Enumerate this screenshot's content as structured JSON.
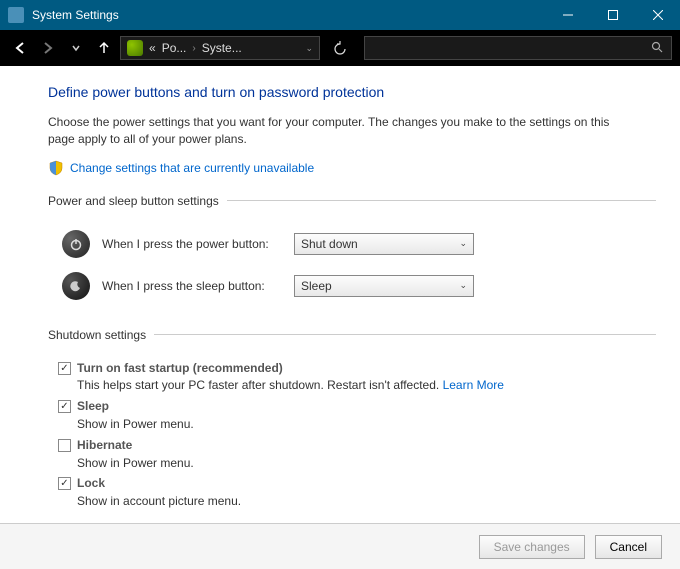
{
  "window": {
    "title": "System Settings"
  },
  "breadcrumb": {
    "segment1": "Po...",
    "segment2": "Syste..."
  },
  "page": {
    "heading": "Define power buttons and turn on password protection",
    "desc": "Choose the power settings that you want for your computer. The changes you make to the settings on this page apply to all of your power plans.",
    "change_link": "Change settings that are currently unavailable"
  },
  "power_sleep": {
    "legend": "Power and sleep button settings",
    "power_label": "When I press the power button:",
    "power_value": "Shut down",
    "sleep_label": "When I press the sleep button:",
    "sleep_value": "Sleep"
  },
  "shutdown": {
    "legend": "Shutdown settings",
    "items": [
      {
        "title": "Turn on fast startup (recommended)",
        "desc": "This helps start your PC faster after shutdown. Restart isn't affected.",
        "learn_more": "Learn More",
        "checked": true
      },
      {
        "title": "Sleep",
        "desc": "Show in Power menu.",
        "checked": true
      },
      {
        "title": "Hibernate",
        "desc": "Show in Power menu.",
        "checked": false
      },
      {
        "title": "Lock",
        "desc": "Show in account picture menu.",
        "checked": true
      }
    ]
  },
  "footer": {
    "save": "Save changes",
    "cancel": "Cancel"
  }
}
